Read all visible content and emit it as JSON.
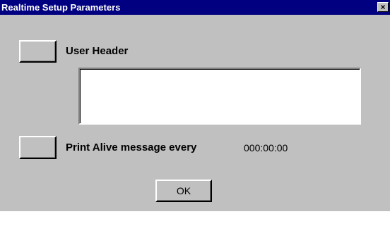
{
  "window": {
    "title": "Realtime Setup Parameters",
    "close_glyph": "×"
  },
  "user_header": {
    "label": "User Header",
    "value": ""
  },
  "alive": {
    "label": "Print Alive message every",
    "interval": "000:00:00"
  },
  "ok_button": {
    "label": "OK"
  },
  "colors": {
    "titlebar": "#000080",
    "face": "#c0c0c0"
  }
}
